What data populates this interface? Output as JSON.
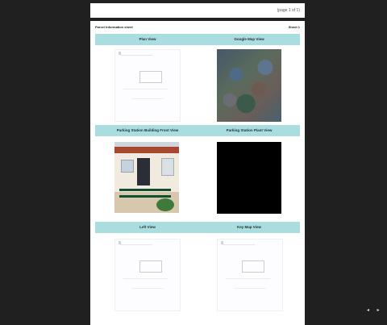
{
  "page_top": {
    "corner_text": "(page 1 of 1)"
  },
  "header": {
    "left": "Parcel Information sheet",
    "right": "Sheet 1"
  },
  "sections": [
    {
      "left_caption": "Plan View",
      "right_caption": "Google Map View"
    },
    {
      "left_caption": "Parking Station Building Front View",
      "right_caption": "Parking Station Plant View"
    },
    {
      "left_caption": "Left View",
      "right_caption": "Key Map View"
    }
  ],
  "images": {
    "row1_left": "plan-sketch",
    "row1_right": "satellite-image",
    "row2_left": "building-photo",
    "row2_right": "black-image",
    "row3_left": "plan-sketch",
    "row3_right": "plan-sketch"
  },
  "nav": {
    "dots": "◂ ▸"
  },
  "colors": {
    "band": "#a9dde0",
    "background": "#202020"
  }
}
